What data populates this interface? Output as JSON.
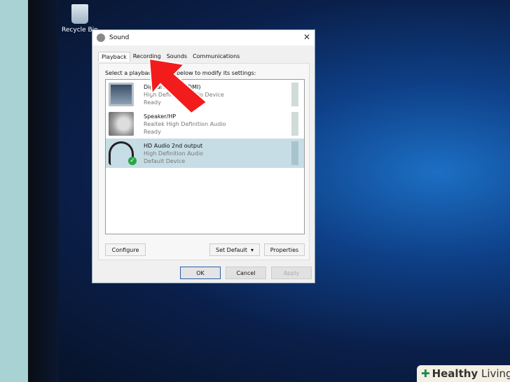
{
  "desktop": {
    "recycle_bin": "Recycle Bin"
  },
  "dialog": {
    "title": "Sound",
    "close": "✕",
    "tabs": [
      "Playback",
      "Recording",
      "Sounds",
      "Communications"
    ],
    "prompt": "Select a playback device below to modify its settings:",
    "devices": [
      {
        "name": "Digital Audio (HDMI)",
        "driver": "High Definition Audio Device",
        "status": "Ready"
      },
      {
        "name": "Speaker/HP",
        "driver": "Realtek High Definition Audio",
        "status": "Ready"
      },
      {
        "name": "HD Audio 2nd output",
        "driver": "High Definition Audio",
        "status": "Default Device"
      }
    ],
    "buttons": {
      "configure": "Configure",
      "set_default": "Set Default",
      "properties": "Properties",
      "ok": "OK",
      "cancel": "Cancel",
      "apply": "Apply"
    }
  },
  "watermark": {
    "brand_bold": "Healthy",
    "brand_light": " Living"
  }
}
